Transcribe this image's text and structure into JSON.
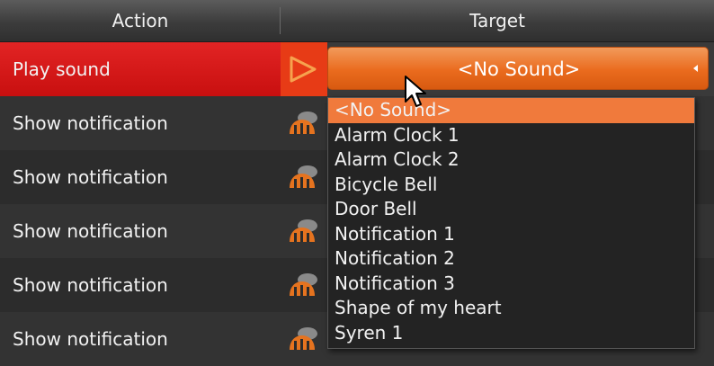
{
  "header": {
    "action_label": "Action",
    "target_label": "Target"
  },
  "rows": [
    {
      "action": "Play sound"
    },
    {
      "action": "Show notification"
    },
    {
      "action": "Show notification"
    },
    {
      "action": "Show notification"
    },
    {
      "action": "Show notification"
    },
    {
      "action": "Show notification"
    }
  ],
  "combo": {
    "selected": "<No Sound>"
  },
  "dropdown": {
    "options": [
      "<No Sound>",
      "Alarm Clock 1",
      "Alarm Clock 2",
      "Bicycle Bell",
      "Door Bell",
      "Notification 1",
      "Notification 2",
      "Notification 3",
      "Shape of my heart",
      "Syren 1"
    ],
    "highlighted_index": 0
  },
  "colors": {
    "selected_row": "#d41a1a",
    "accent_orange": "#ea6b1e",
    "highlight": "#f07a3c"
  },
  "icons": [
    "play-icon",
    "bell-icon",
    "chevron-icon",
    "mouse-cursor-icon"
  ]
}
